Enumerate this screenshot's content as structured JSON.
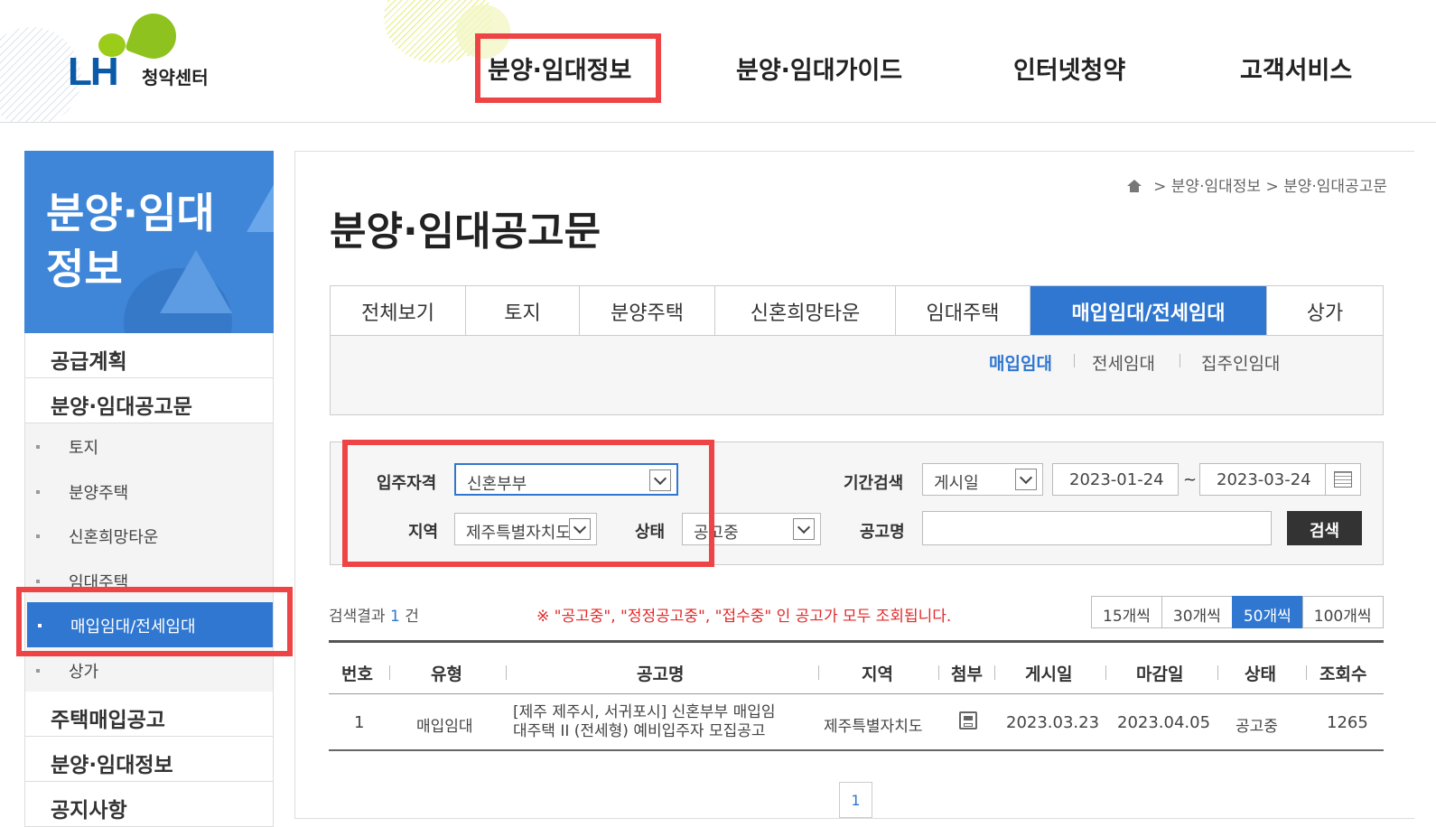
{
  "header": {
    "logo_text": "LH",
    "logo_sub": "청약센터",
    "nav": [
      "분양·임대정보",
      "분양·임대가이드",
      "인터넷청약",
      "고객서비스"
    ]
  },
  "sidebar": {
    "title_line1": "분양·임대",
    "title_line2": "정보",
    "items_top": [
      "공급계획",
      "분양·임대공고문"
    ],
    "sub_items": [
      "토지",
      "분양주택",
      "신혼희망타운",
      "임대주택",
      "매입임대/전세임대",
      "상가"
    ],
    "items_bottom": [
      "주택매입공고",
      "분양·임대정보",
      "공지사항"
    ]
  },
  "breadcrumb": {
    "sep": ">",
    "level1": "분양·임대정보",
    "level2": "분양·임대공고문"
  },
  "page_title": "분양·임대공고문",
  "tabs": [
    "전체보기",
    "토지",
    "분양주택",
    "신혼희망타운",
    "임대주택",
    "매입임대/전세임대",
    "상가"
  ],
  "subtabs": [
    "매입임대",
    "전세임대",
    "집주인임대"
  ],
  "search": {
    "qualification_label": "입주자격",
    "qualification_value": "신혼부부",
    "region_label": "지역",
    "region_value": "제주특별자치도",
    "status_label": "상태",
    "status_value": "공고중",
    "period_label": "기간검색",
    "period_type": "게시일",
    "date_from": "2023-01-24",
    "tilde": "~",
    "date_to": "2023-03-24",
    "name_label": "공고명",
    "name_value": "",
    "search_button": "검색"
  },
  "result": {
    "prefix": "검색결과",
    "count": "1",
    "suffix": "건"
  },
  "notice": "※ \"공고중\", \"정정공고중\", \"접수중\" 인 공고가 모두 조회됩니다.",
  "page_sizes": [
    "15개씩",
    "30개씩",
    "50개씩",
    "100개씩"
  ],
  "table": {
    "headers": [
      "번호",
      "유형",
      "공고명",
      "지역",
      "첨부",
      "게시일",
      "마감일",
      "상태",
      "조회수"
    ],
    "rows": [
      {
        "no": "1",
        "type": "매입임대",
        "title_line1": "[제주 제주시, 서귀포시] 신혼부부 매입임",
        "title_line2": "대주택 II (전세형) 예비입주자 모집공고",
        "region": "제주특별자치도",
        "attach_icon": "document-icon",
        "posted": "2023.03.23",
        "deadline": "2023.04.05",
        "status": "공고중",
        "views": "1265"
      }
    ]
  },
  "pagination": {
    "current": "1"
  },
  "colors": {
    "accent": "#2f77d0",
    "highlight": "#ee4445",
    "brand": "#0b5aa8",
    "brand_green": "#8dc21f"
  }
}
